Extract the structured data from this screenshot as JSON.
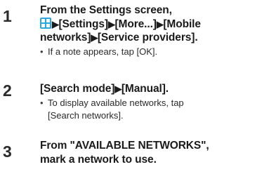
{
  "steps": [
    {
      "number": "1",
      "line1": "From the Settings screen,",
      "line2_icon": "apps-grid-icon",
      "line2_items": [
        "[Settings]",
        "[More...]",
        "[Mobile"
      ],
      "line3_items": [
        "networks]",
        "[Service providers]."
      ],
      "arrow": "▶",
      "note": "If a note appears, tap [OK]."
    },
    {
      "number": "2",
      "items": [
        "[Search mode]",
        "[Manual]."
      ],
      "arrow": "▶",
      "note_line1": "To display available networks, tap",
      "note_line2": "[Search networks]."
    },
    {
      "number": "3",
      "line1": "From \"AVAILABLE NETWORKS\",",
      "line2": "mark a network to use."
    }
  ],
  "bullet": "•",
  "colors": {
    "icon_blue": "#2aa9e0",
    "text": "#1a1a1a"
  }
}
